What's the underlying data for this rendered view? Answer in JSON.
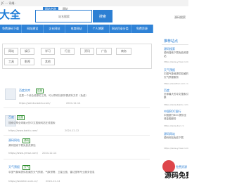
{
  "topbar": {
    "left_text": "JC ··· 讯端 ·",
    "right_text": ""
  },
  "logo": {
    "text": "大全"
  },
  "search": {
    "tabs": [
      "网站名称",
      "网址"
    ],
    "placeholder": "站名搜索",
    "button_label": "搜索"
  },
  "top_right": {
    "text": "源码搜索"
  },
  "nav": {
    "items": [
      "免费源码下载",
      "网站建设",
      "企业网站",
      "电商网站",
      "个人博客",
      "网站目录分类",
      "免费资源"
    ]
  },
  "tags": {
    "row1": [
      "网站",
      "娱乐",
      "学习",
      "行业",
      "资讯",
      "广告",
      "商务"
    ],
    "row2": [
      "工具",
      "影视",
      "其他"
    ]
  },
  "list": {
    "items": [
      {
        "title": "百度文库",
        "badge": "百度",
        "desc": "这是一个综合资源的工具，可以帮你找到所需资料文件（免费）",
        "url": "https://wenku.baidu.com/",
        "date": "2024-12-14"
      },
      {
        "title": "百度",
        "badge": "百度",
        "desc": "搜索引擎全球最大的中文搜索网站在线搜索",
        "url": "https://www.baidu.com/",
        "date": "2024-12-12"
      },
      {
        "title": "源码网站",
        "badge": "源码",
        "desc": "源码搜索下载免费资源站",
        "url": "https://www.ymwz.com/",
        "date": "2024-12-14"
      },
      {
        "title": "天气预报",
        "badge": "天气",
        "desc": "中国气象局提供权威的天气预报、气象预警、卫星云图、雷达图等专业服务信息",
        "url": "https://weather.com.cn/",
        "date": "2024-12-14"
      }
    ]
  },
  "sidebar": {
    "title": "推荐站点",
    "items": [
      {
        "title": "源码搜索",
        "text": "源码搜索下载免费资源站",
        "url": "https://www.ymwz.com"
      },
      {
        "title": "天气预报",
        "text": "中国气象局提供权威的天气预报服务",
        "url": "https://weather.com.cn"
      },
      {
        "title": "百度",
        "text": "全球最大的中文搜索引擎",
        "url": "https://www.baidu.com"
      },
      {
        "title": "中国BOC银行",
        "text": "中国银行BOC提供全球金融服务",
        "url": "https://www.boc.cn"
      },
      {
        "title": "源码网站",
        "text": "源码网站免费下载",
        "url": "https://www.ymwz.com"
      }
    ]
  },
  "watermark": {
    "text": "源码免费",
    "sub": "免费资源"
  }
}
